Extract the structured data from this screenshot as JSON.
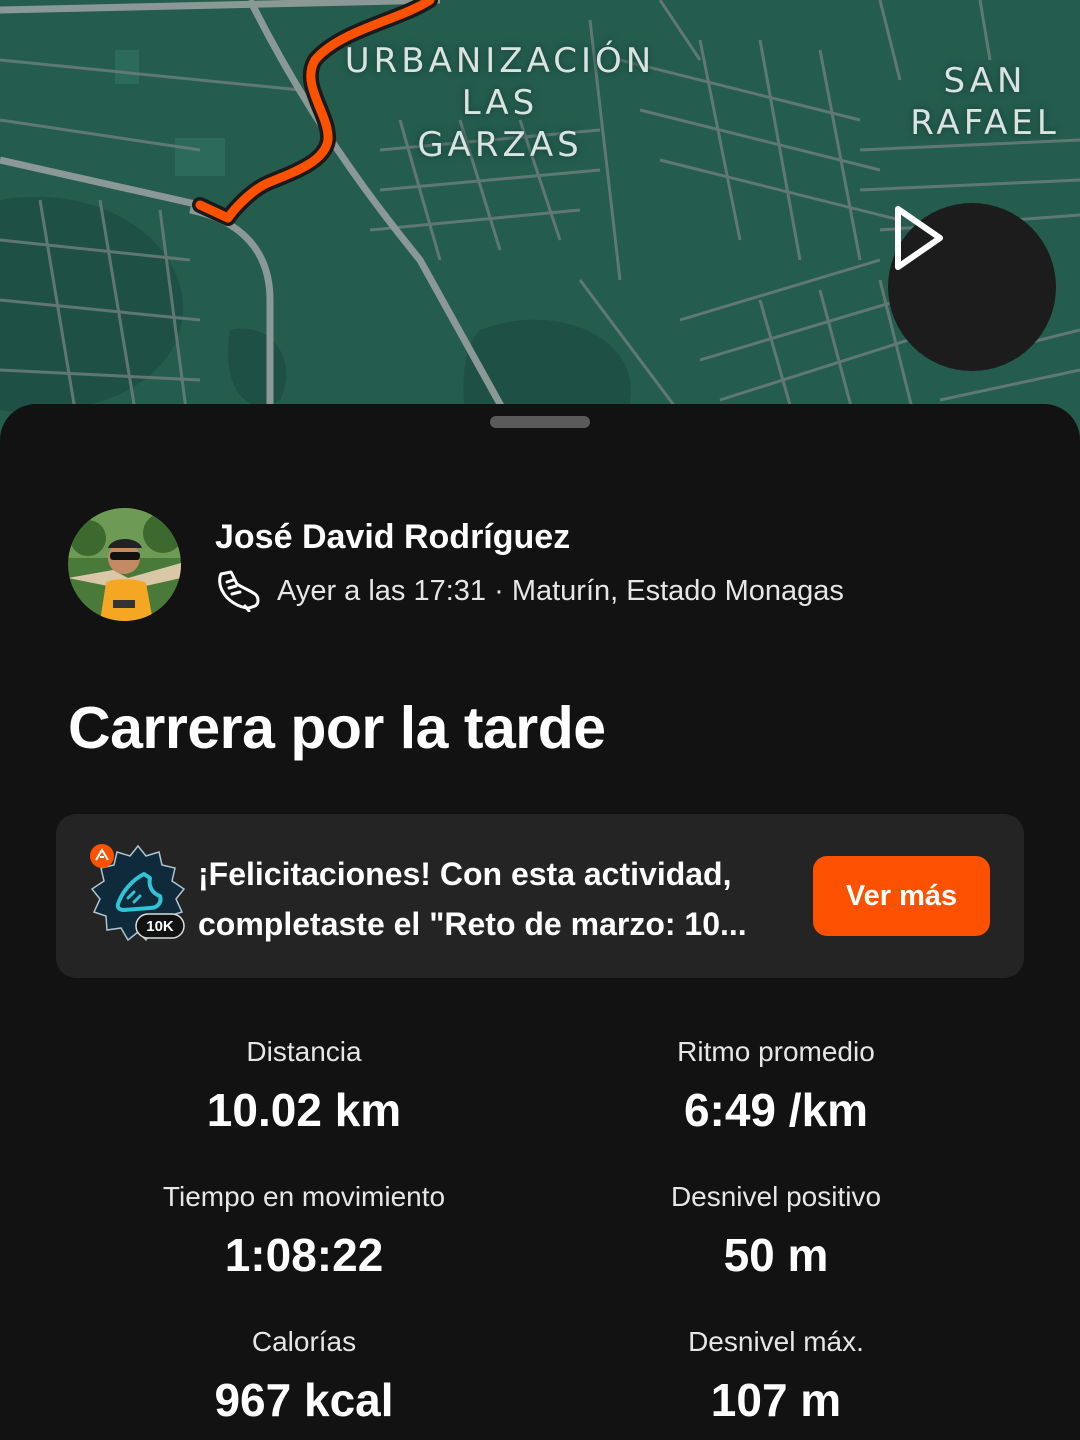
{
  "map": {
    "labels": [
      {
        "id": "urbanizacion",
        "lines": [
          "URBANIZACIÓN",
          "LAS",
          "GARZAS"
        ]
      },
      {
        "id": "san-rafael",
        "lines": [
          "SAN",
          "RAFAEL"
        ]
      }
    ],
    "route_color": "#fc5200",
    "play_icon": "play-icon"
  },
  "athlete": {
    "name": "José David Rodríguez",
    "activity_icon": "running-shoe-icon",
    "meta": "Ayer a las 17:31 · Maturín, Estado Monagas"
  },
  "activity": {
    "title": "Carrera por la tarde"
  },
  "achievement": {
    "badge_label": "10K",
    "line1": "¡Felicitaciones! Con esta actividad,",
    "line2": "completaste el \"Reto de marzo: 10...",
    "button_label": "Ver más",
    "accent": "#fc5200"
  },
  "stats": [
    {
      "label": "Distancia",
      "value": "10.02 km"
    },
    {
      "label": "Ritmo promedio",
      "value": "6:49 /km"
    },
    {
      "label": "Tiempo en movimiento",
      "value": "1:08:22"
    },
    {
      "label": "Desnivel positivo",
      "value": "50 m"
    },
    {
      "label": "Calorías",
      "value": "967 kcal"
    },
    {
      "label": "Desnivel máx.",
      "value": "107 m"
    }
  ]
}
